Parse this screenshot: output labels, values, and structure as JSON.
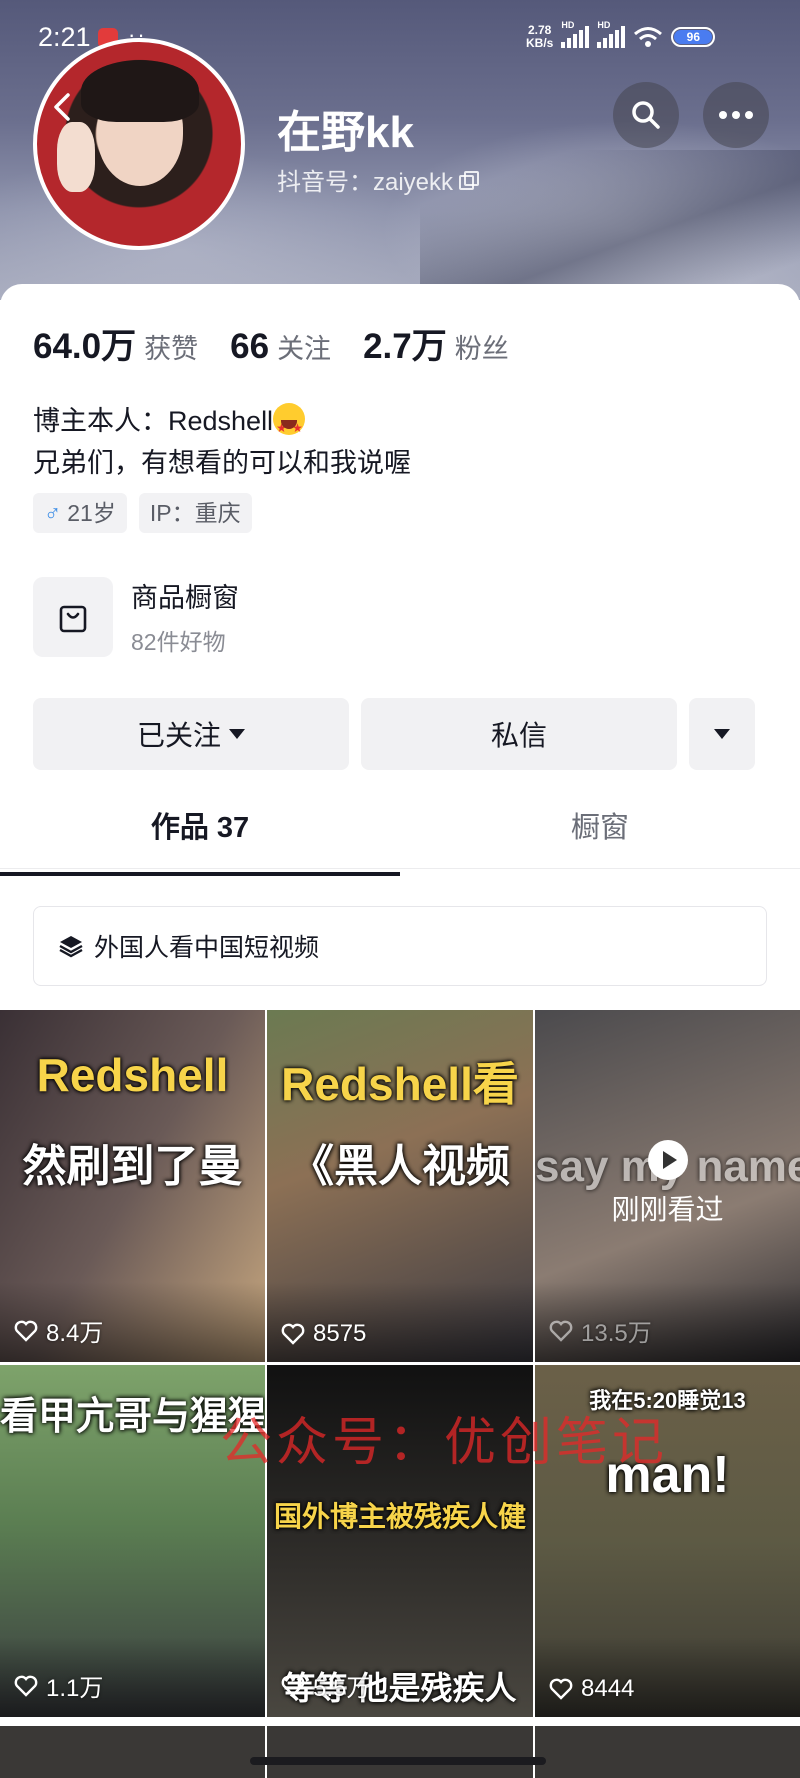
{
  "status_bar": {
    "time": "2:21",
    "speed_value": "2.78",
    "speed_unit": "KB/s",
    "hd1": "HD",
    "hd2": "HD",
    "battery": "96"
  },
  "profile": {
    "name": "在野kk",
    "douyin_id": "抖音号：zaiyekk",
    "stats": [
      {
        "value": "64.0万",
        "label": "获赞"
      },
      {
        "value": "66",
        "label": "关注"
      },
      {
        "value": "2.7万",
        "label": "粉丝"
      }
    ],
    "bio_line1": "博主本人：Redshell",
    "bio_line2": "兄弟们，有想看的可以和我说喔",
    "tag_age": "21岁",
    "tag_ip": "IP：重庆"
  },
  "shop": {
    "title": "商品橱窗",
    "subtitle": "82件好物"
  },
  "actions": {
    "follow": "已关注",
    "message": "私信"
  },
  "tabs": [
    {
      "label": "作品 37"
    },
    {
      "label": "橱窗"
    }
  ],
  "collection": {
    "label": "外国人看中国短视频"
  },
  "videos": [
    {
      "cap1": "Redshell",
      "cap2": "然刷到了曼",
      "likes": "8.4万"
    },
    {
      "cap1": "Redshell看",
      "cap2": "《黑人视频",
      "likes": "8575"
    },
    {
      "cap2": "say my name!",
      "watched": "刚刚看过",
      "likes": "13.5万"
    },
    {
      "cap2": "看甲亢哥与猩猩",
      "likes": "1.1万"
    },
    {
      "cap1": "国外博主被残疾人健",
      "cap2": "等等 他是残疾人",
      "likes": "5.5万"
    },
    {
      "cap1": "我在5:20睡觉13",
      "cap2": "man!",
      "likes": "8444"
    }
  ],
  "watermark": "公众号：优创笔记"
}
